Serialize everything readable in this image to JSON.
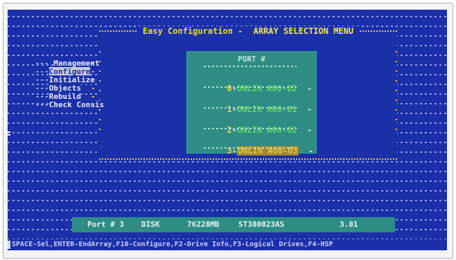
{
  "title": {
    "part1": "Easy Configuration - ",
    "part2": "ARRAY SELECTION MENU"
  },
  "menu": {
    "items": [
      {
        "label": "Management"
      },
      {
        "label": "Configure"
      },
      {
        "label": "Initialize"
      },
      {
        "label": "Objects"
      },
      {
        "label": "Rebuild"
      },
      {
        "label": "Check Consis"
      }
    ],
    "selected_index": 1
  },
  "ports": {
    "header": "PORT #",
    "rows": [
      {
        "num": "0",
        "value": "ONLIN A00-02"
      },
      {
        "num": "1",
        "value": "ONLIN A00-01"
      },
      {
        "num": "2",
        "value": "ONLIN A00-02"
      },
      {
        "num": "3",
        "value": "ONLIN A00-03"
      }
    ],
    "selected_index": 3
  },
  "info": {
    "port": "Port # 3",
    "type": "DISK",
    "size": "76228MB",
    "model": "ST380023AS",
    "rev": "3.01"
  },
  "help": {
    "text": "SPACE-Sel,ENTER-EndArray,F10-Configure,F2-Drive Info,F3-Logical Drives,F4-HSP"
  },
  "colors": {
    "background": "#1b2fa8",
    "panel": "#2e8c84",
    "accent_yellow": "#e6d24a",
    "online_green": "#5ed66a",
    "selected_highlight": "#a4882c"
  }
}
